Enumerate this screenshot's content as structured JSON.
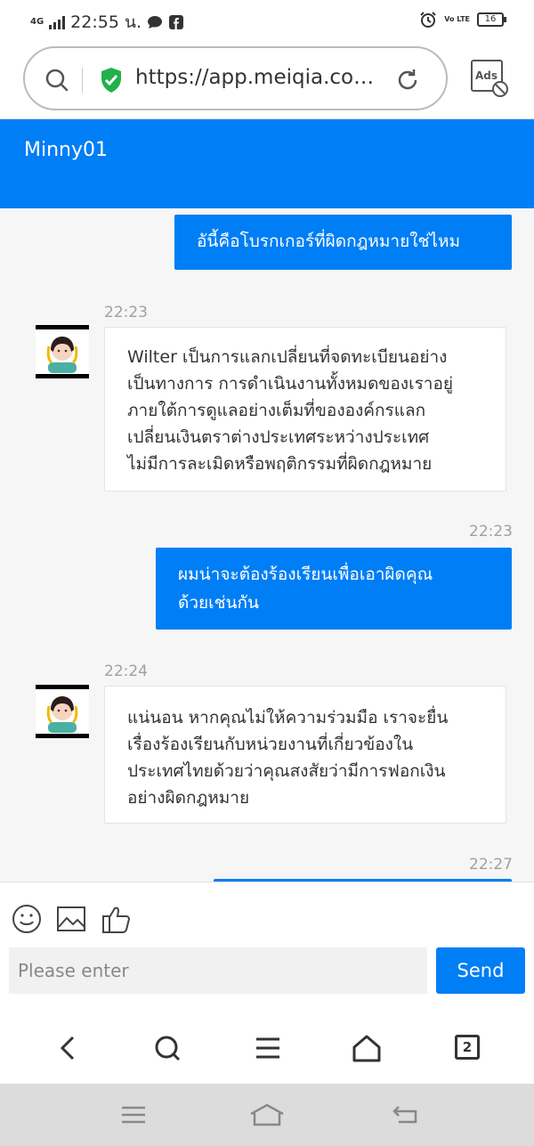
{
  "status_bar": {
    "network": "4G",
    "time": "22:55 น.",
    "volte": "Vo LTE",
    "battery": "16"
  },
  "browser": {
    "url": "https://app.meiqia.com/...",
    "ads_label": "Ads"
  },
  "chat": {
    "title": "Minny01",
    "messages": [
      {
        "side": "out",
        "text": "อันี้คือโบรกเกอร์ที่ผิดกฎหมายใช่ไหม"
      },
      {
        "side": "in",
        "time": "22:23",
        "lines": [
          "Wilter เป็นการแลกเปลี่ยนที่จดทะเบียนอย่าง",
          "เป็นทางการ การดำเนินงานทั้งหมดของเราอยู่",
          "ภายใต้การดูแลอย่างเต็มที่ขององค์กรแลก",
          "เปลี่ยนเงินตราต่างประเทศระหว่างประเทศ",
          "ไม่มีการละเมิดหรือพฤติกรรมที่ผิดกฎหมาย"
        ]
      },
      {
        "side": "out",
        "time": "22:23",
        "lines": [
          "ผมน่าจะต้องร้องเรียนเพื่อเอาผิดคุณ",
          "ด้วยเช่นกัน"
        ]
      },
      {
        "side": "in",
        "time": "22:24",
        "lines": [
          "แน่นอน หากคุณไม่ให้ความร่วมมือ เราจะยื่น",
          "เรื่องร้องเรียนกับหน่วยงานที่เกี่ยวข้องใน",
          "ประเทศไทยด้วยว่าคุณสงสัยว่ามีการฟอกเงิน",
          "อย่างผิดกฎหมาย"
        ]
      },
      {
        "side": "out",
        "time": "22:27"
      }
    ]
  },
  "composer": {
    "placeholder": "Please enter",
    "send_label": "Send",
    "tabs_count": "2"
  },
  "colors": {
    "accent": "#007ef5",
    "chat_bg": "#f6f6f7"
  },
  "icons": [
    "search-icon",
    "shield-check-icon",
    "reload-icon",
    "ads-block-icon",
    "emoji-icon",
    "image-icon",
    "thumbs-up-icon",
    "back-icon",
    "home-icon",
    "menu-icon",
    "tabs-icon"
  ]
}
